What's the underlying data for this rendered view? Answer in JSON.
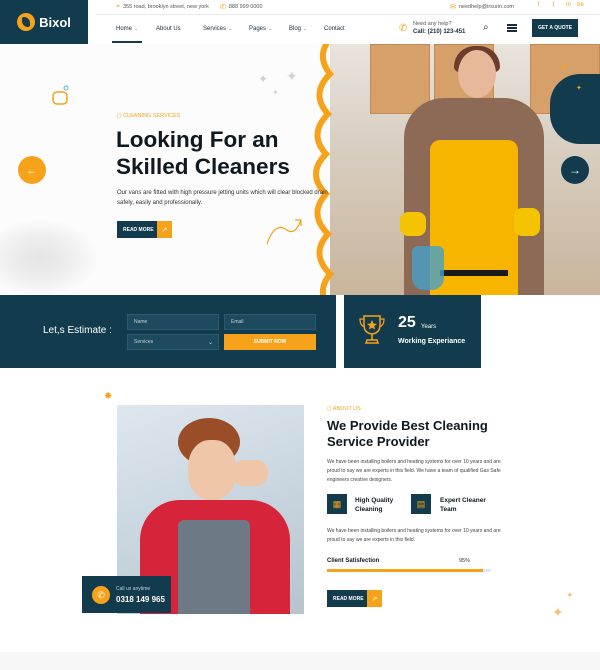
{
  "brand": {
    "name": "Bixol"
  },
  "topbar": {
    "address": "355 road, brooklyn street, new york",
    "phone": "888 999 0000",
    "email": "needhelp@irsurin.com",
    "social": [
      "f",
      "t",
      "in",
      "be"
    ]
  },
  "nav": {
    "items": [
      {
        "label": "Home",
        "dropdown": true
      },
      {
        "label": "About Us",
        "dropdown": false
      },
      {
        "label": "Services",
        "dropdown": true
      },
      {
        "label": "Pages",
        "dropdown": true
      },
      {
        "label": "Blog",
        "dropdown": true
      },
      {
        "label": "Contact",
        "dropdown": false
      }
    ],
    "help_label": "Need any help?",
    "help_phone": "Call: (210) 123-451",
    "quote_button": "GET A QUOTE"
  },
  "hero": {
    "eyebrow": "CLEANING SERVICES",
    "title": "Looking For an Skilled Cleaners",
    "description": "Our vans are fitted with high pressure jetting units which will clear blocked drain safely, easily and professionally.",
    "button": "READ MORE"
  },
  "estimate": {
    "label": "Let,s Estimate :",
    "name_placeholder": "Name",
    "email_placeholder": "Email",
    "services_value": "Services",
    "submit": "SUBMIT NOW"
  },
  "experience": {
    "number": "25",
    "unit": "Years",
    "label": "Working Experiance"
  },
  "about": {
    "eyebrow": "ABOUT US",
    "title": "We Provide Best Cleaning Service Provider",
    "desc1": "We have been installing boilers and heating systems for over 10 years and are proud to say we are experts in this field. We have a team of qualified Gas Safe engineers creative designers.",
    "features": [
      "High Quality Cleaning",
      "Expert Cleaner Team"
    ],
    "desc2": "We have been installing boilers and heating systems for over 10 years and are proud to say we are experts in this field.",
    "progress_label": "Client Satisfection",
    "progress_value": "95%",
    "progress_fraction": 0.95,
    "button": "READ MORE",
    "call_label": "Call us anytime",
    "call_number": "0318 149 965"
  },
  "colors": {
    "navy": "#123b4d",
    "orange": "#f7a21b"
  }
}
